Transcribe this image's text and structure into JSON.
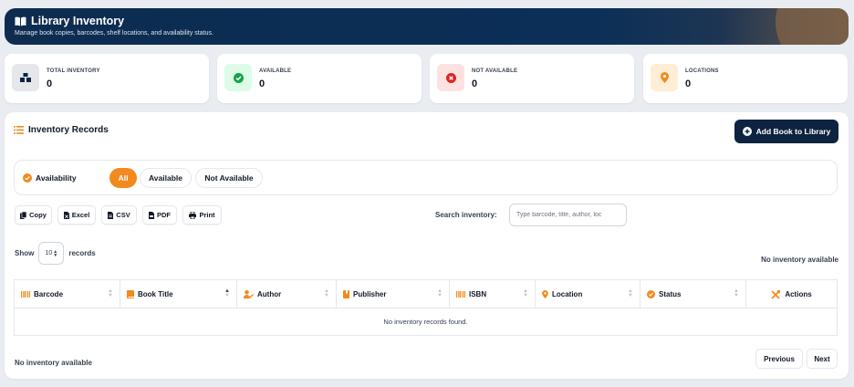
{
  "header": {
    "title": "Library Inventory",
    "subtitle": "Manage book copies, barcodes, shelf locations, and availability status.",
    "icon": "book-open-icon"
  },
  "stats": [
    {
      "label": "TOTAL INVENTORY",
      "value": "0",
      "icon": "warehouse-icon",
      "color": "#0d2340",
      "bg": "#e5e7eb"
    },
    {
      "label": "AVAILABLE",
      "value": "0",
      "icon": "check-circle-icon",
      "color": "#16a34a",
      "bg": "#dcfce7"
    },
    {
      "label": "NOT AVAILABLE",
      "value": "0",
      "icon": "x-circle-icon",
      "color": "#dc2626",
      "bg": "#fee2e2"
    },
    {
      "label": "LOCATIONS",
      "value": "0",
      "icon": "map-pin-icon",
      "color": "#f28a1d",
      "bg": "#ffedd5"
    }
  ],
  "panel": {
    "title": "Inventory Records",
    "add_button": "Add Book to Library"
  },
  "filter": {
    "label": "Availability",
    "options": [
      "All",
      "Available",
      "Not Available"
    ],
    "selected": "All"
  },
  "export_buttons": [
    "Copy",
    "Excel",
    "CSV",
    "PDF",
    "Print"
  ],
  "search": {
    "label": "Search inventory:",
    "placeholder": "Type barcode, title, author, loc"
  },
  "length": {
    "show": "Show",
    "value": "10",
    "records": "records"
  },
  "empty_info_top": "No inventory available",
  "table": {
    "columns": [
      "Barcode",
      "Book Title",
      "Author",
      "Publisher",
      "ISBN",
      "Location",
      "Status",
      "Actions"
    ],
    "empty_message": "No inventory records found."
  },
  "footer": {
    "info": "No inventory available",
    "previous": "Previous",
    "next": "Next"
  },
  "colors": {
    "accent": "#f28a1d",
    "navy": "#0d2340"
  }
}
